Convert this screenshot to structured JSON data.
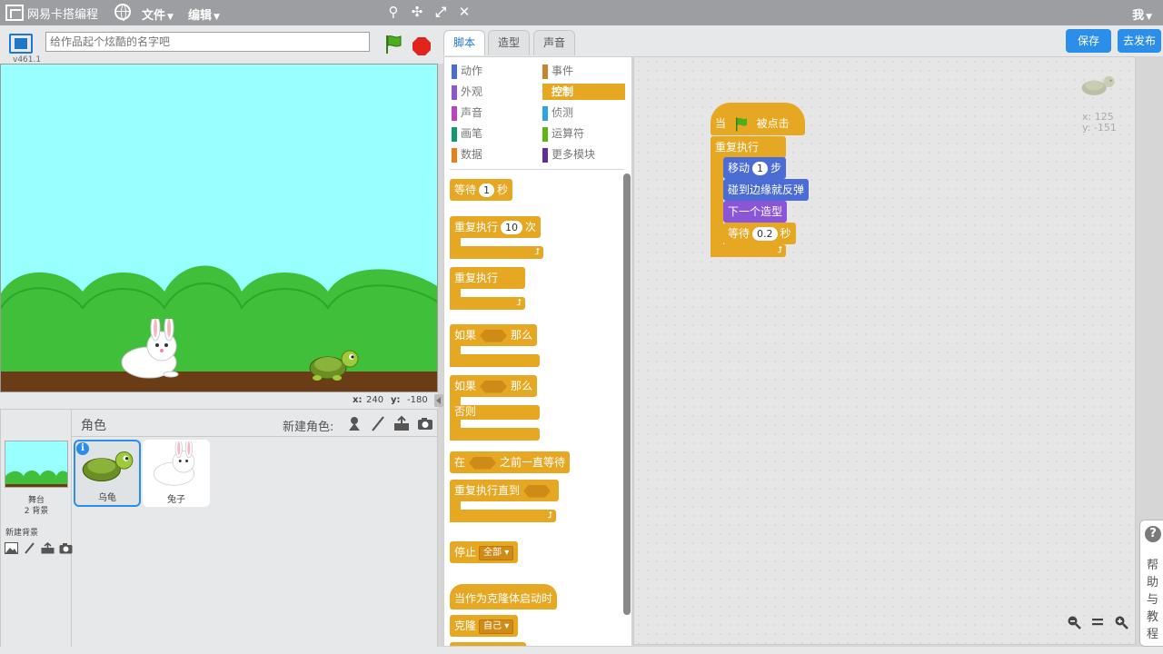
{
  "menubar": {
    "logo_text": "网易卡搭编程",
    "file_menu": "文件",
    "edit_menu": "编辑",
    "user": "我"
  },
  "stage_header": {
    "version": "v461.1",
    "title_placeholder": "给作品起个炫酷的名字吧"
  },
  "stage_coords": {
    "x_label": "x:",
    "x_value": "240",
    "y_label": "y:",
    "y_value": "-180"
  },
  "sprites_panel": {
    "stage_label": "舞台",
    "stage_sub": "2 背景",
    "new_backdrop": "新建背景",
    "title": "角色",
    "new_sprite": "新建角色:",
    "sprites": [
      {
        "name": "乌龟",
        "selected": true
      },
      {
        "name": "兔子",
        "selected": false
      }
    ]
  },
  "tabs": {
    "scripts": "脚本",
    "costumes": "造型",
    "sounds": "声音"
  },
  "actions": {
    "save": "保存",
    "publish": "去发布"
  },
  "categories": [
    {
      "label": "动作",
      "color": "#4a6cd4"
    },
    {
      "label": "事件",
      "color": "#c88330"
    },
    {
      "label": "外观",
      "color": "#8a55d7"
    },
    {
      "label": "控制",
      "color": "#e6a822",
      "selected": true
    },
    {
      "label": "声音",
      "color": "#bb42c3"
    },
    {
      "label": "侦测",
      "color": "#2ca5e2"
    },
    {
      "label": "画笔",
      "color": "#0e9a6c"
    },
    {
      "label": "运算符",
      "color": "#5cb712"
    },
    {
      "label": "数据",
      "color": "#ee7d16"
    },
    {
      "label": "更多模块",
      "color": "#632d99"
    }
  ],
  "palette": {
    "wait": {
      "pre": "等待",
      "val": "1",
      "post": "秒"
    },
    "repeat": {
      "pre": "重复执行",
      "val": "10",
      "post": "次"
    },
    "forever": "重复执行",
    "if_then": {
      "pre": "如果",
      "post": "那么"
    },
    "if_else": {
      "pre": "如果",
      "post": "那么",
      "else": "否则"
    },
    "wait_until": {
      "pre": "在",
      "post": "之前一直等待"
    },
    "repeat_until": "重复执行直到",
    "stop": {
      "pre": "停止",
      "opt": "全部"
    },
    "clone_start": "当作为克隆体启动时",
    "clone": {
      "pre": "克隆",
      "opt": "自己"
    }
  },
  "script": {
    "when_flag": {
      "pre": "当",
      "post": "被点击"
    },
    "forever": "重复执行",
    "move": {
      "pre": "移动",
      "val": "1",
      "post": "步"
    },
    "bounce": "碰到边缘就反弹",
    "next_costume": "下一个造型",
    "wait": {
      "pre": "等待",
      "val": "0.2",
      "post": "秒"
    },
    "sprite_x": "x: 125",
    "sprite_y": "y: -151"
  },
  "help": {
    "label": "帮助与教程"
  }
}
